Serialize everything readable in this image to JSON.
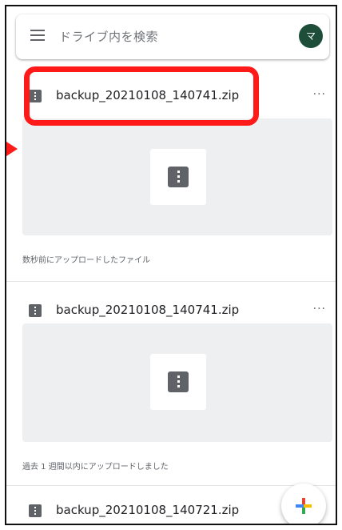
{
  "search": {
    "placeholder": "ドライブ内を検索",
    "avatar_initial": "マ"
  },
  "cards": [
    {
      "file_name": "backup_20210108_140741.zip",
      "caption": "数秒前にアップロードしたファイル",
      "more": "···"
    },
    {
      "file_name": "backup_20210108_140741.zip",
      "caption": "過去 1 週間以内にアップロードしました",
      "more": "···"
    },
    {
      "file_name": "backup_20210108_140721.zip",
      "more": "···"
    }
  ],
  "colors": {
    "highlight": "#ff1a1a",
    "avatar": "#1e4d3a",
    "thumb_bg": "#eeeff0"
  },
  "icons": {
    "menu": "hamburger-menu-icon",
    "file": "zip-file-icon",
    "more": "more-horiz-icon",
    "fab": "plus-icon"
  }
}
